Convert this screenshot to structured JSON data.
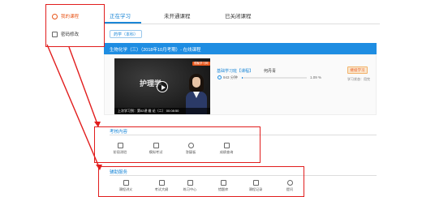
{
  "sidebar": {
    "items": [
      {
        "label": "我的课程",
        "icon": "home-icon",
        "active": true
      },
      {
        "label": "密码修改",
        "icon": "edit-icon",
        "active": false
      }
    ]
  },
  "tabs": [
    {
      "label": "正在学习",
      "active": true
    },
    {
      "label": "未开通课程",
      "active": false
    },
    {
      "label": "已关闭课程",
      "active": false
    }
  ],
  "filter_pill": "药学（本科）",
  "course": {
    "title": "生物化学（三）（2018年10月考期）- 在线课程",
    "video": {
      "logo": "德聚学习网",
      "heading": "护理学",
      "caption": "上次学习到：第02讲 维 论（二） 00:08:50"
    },
    "lesson_title": "基础学习班【课程】",
    "teacher": "何丹青",
    "duration": "943 分钟",
    "progress_text": "1.09 %",
    "progress_fraction": 0.0109,
    "continue_label": "继续学习",
    "status_text": "学习状态：用完"
  },
  "exam_section": {
    "title": "考核内容",
    "items": [
      {
        "label": "阶段测验",
        "icon": "chart-icon"
      },
      {
        "label": "模拟考试",
        "icon": "document-icon"
      },
      {
        "label": "答疑板",
        "icon": "question-icon"
      },
      {
        "label": "成绩查询",
        "icon": "check-icon"
      }
    ]
  },
  "service_section": {
    "title": "辅助服务",
    "items": [
      {
        "label": "课程讲义",
        "icon": "list-icon"
      },
      {
        "label": "考试大纲",
        "icon": "book-icon"
      },
      {
        "label": "练习中心",
        "icon": "monitor-icon"
      },
      {
        "label": "错题库",
        "icon": "calendar-icon"
      },
      {
        "label": "课程记录",
        "icon": "note-icon"
      },
      {
        "label": "提问",
        "icon": "help-icon"
      }
    ]
  },
  "colors": {
    "accent": "#1e8de2",
    "active_sidebar": "#e8561a",
    "annotation": "#e11d1d"
  }
}
